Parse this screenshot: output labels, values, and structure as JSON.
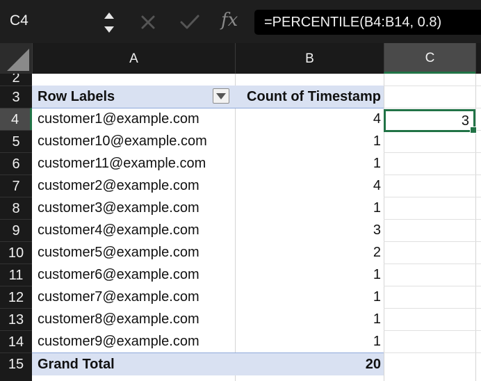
{
  "formula_bar": {
    "name_box": "C4",
    "fx_label": "fx",
    "formula": "=PERCENTILE(B4:B14, 0.8)"
  },
  "columns": [
    "A",
    "B",
    "C"
  ],
  "rows": {
    "partial_label": "2",
    "labels": [
      "3",
      "4",
      "5",
      "6",
      "7",
      "8",
      "9",
      "10",
      "11",
      "12",
      "13",
      "14",
      "15"
    ]
  },
  "pivot": {
    "header": {
      "row_labels": "Row Labels",
      "count_label": "Count of Timestamp"
    },
    "items": [
      {
        "label": "customer1@example.com",
        "count": "4"
      },
      {
        "label": "customer10@example.com",
        "count": "1"
      },
      {
        "label": "customer11@example.com",
        "count": "1"
      },
      {
        "label": "customer2@example.com",
        "count": "4"
      },
      {
        "label": "customer3@example.com",
        "count": "1"
      },
      {
        "label": "customer4@example.com",
        "count": "3"
      },
      {
        "label": "customer5@example.com",
        "count": "2"
      },
      {
        "label": "customer6@example.com",
        "count": "1"
      },
      {
        "label": "customer7@example.com",
        "count": "1"
      },
      {
        "label": "customer8@example.com",
        "count": "1"
      },
      {
        "label": "customer9@example.com",
        "count": "1"
      }
    ],
    "grand_total": {
      "label": "Grand Total",
      "count": "20"
    }
  },
  "selected_cell": {
    "value": "3"
  },
  "colors": {
    "accent": "#217346",
    "pivot_header_bg": "#d9e1f2",
    "chrome_bg": "#1e1e1e"
  },
  "icons": [
    "stepper-icon",
    "cancel-icon",
    "enter-icon",
    "filter-dropdown-icon",
    "select-all-icon"
  ]
}
